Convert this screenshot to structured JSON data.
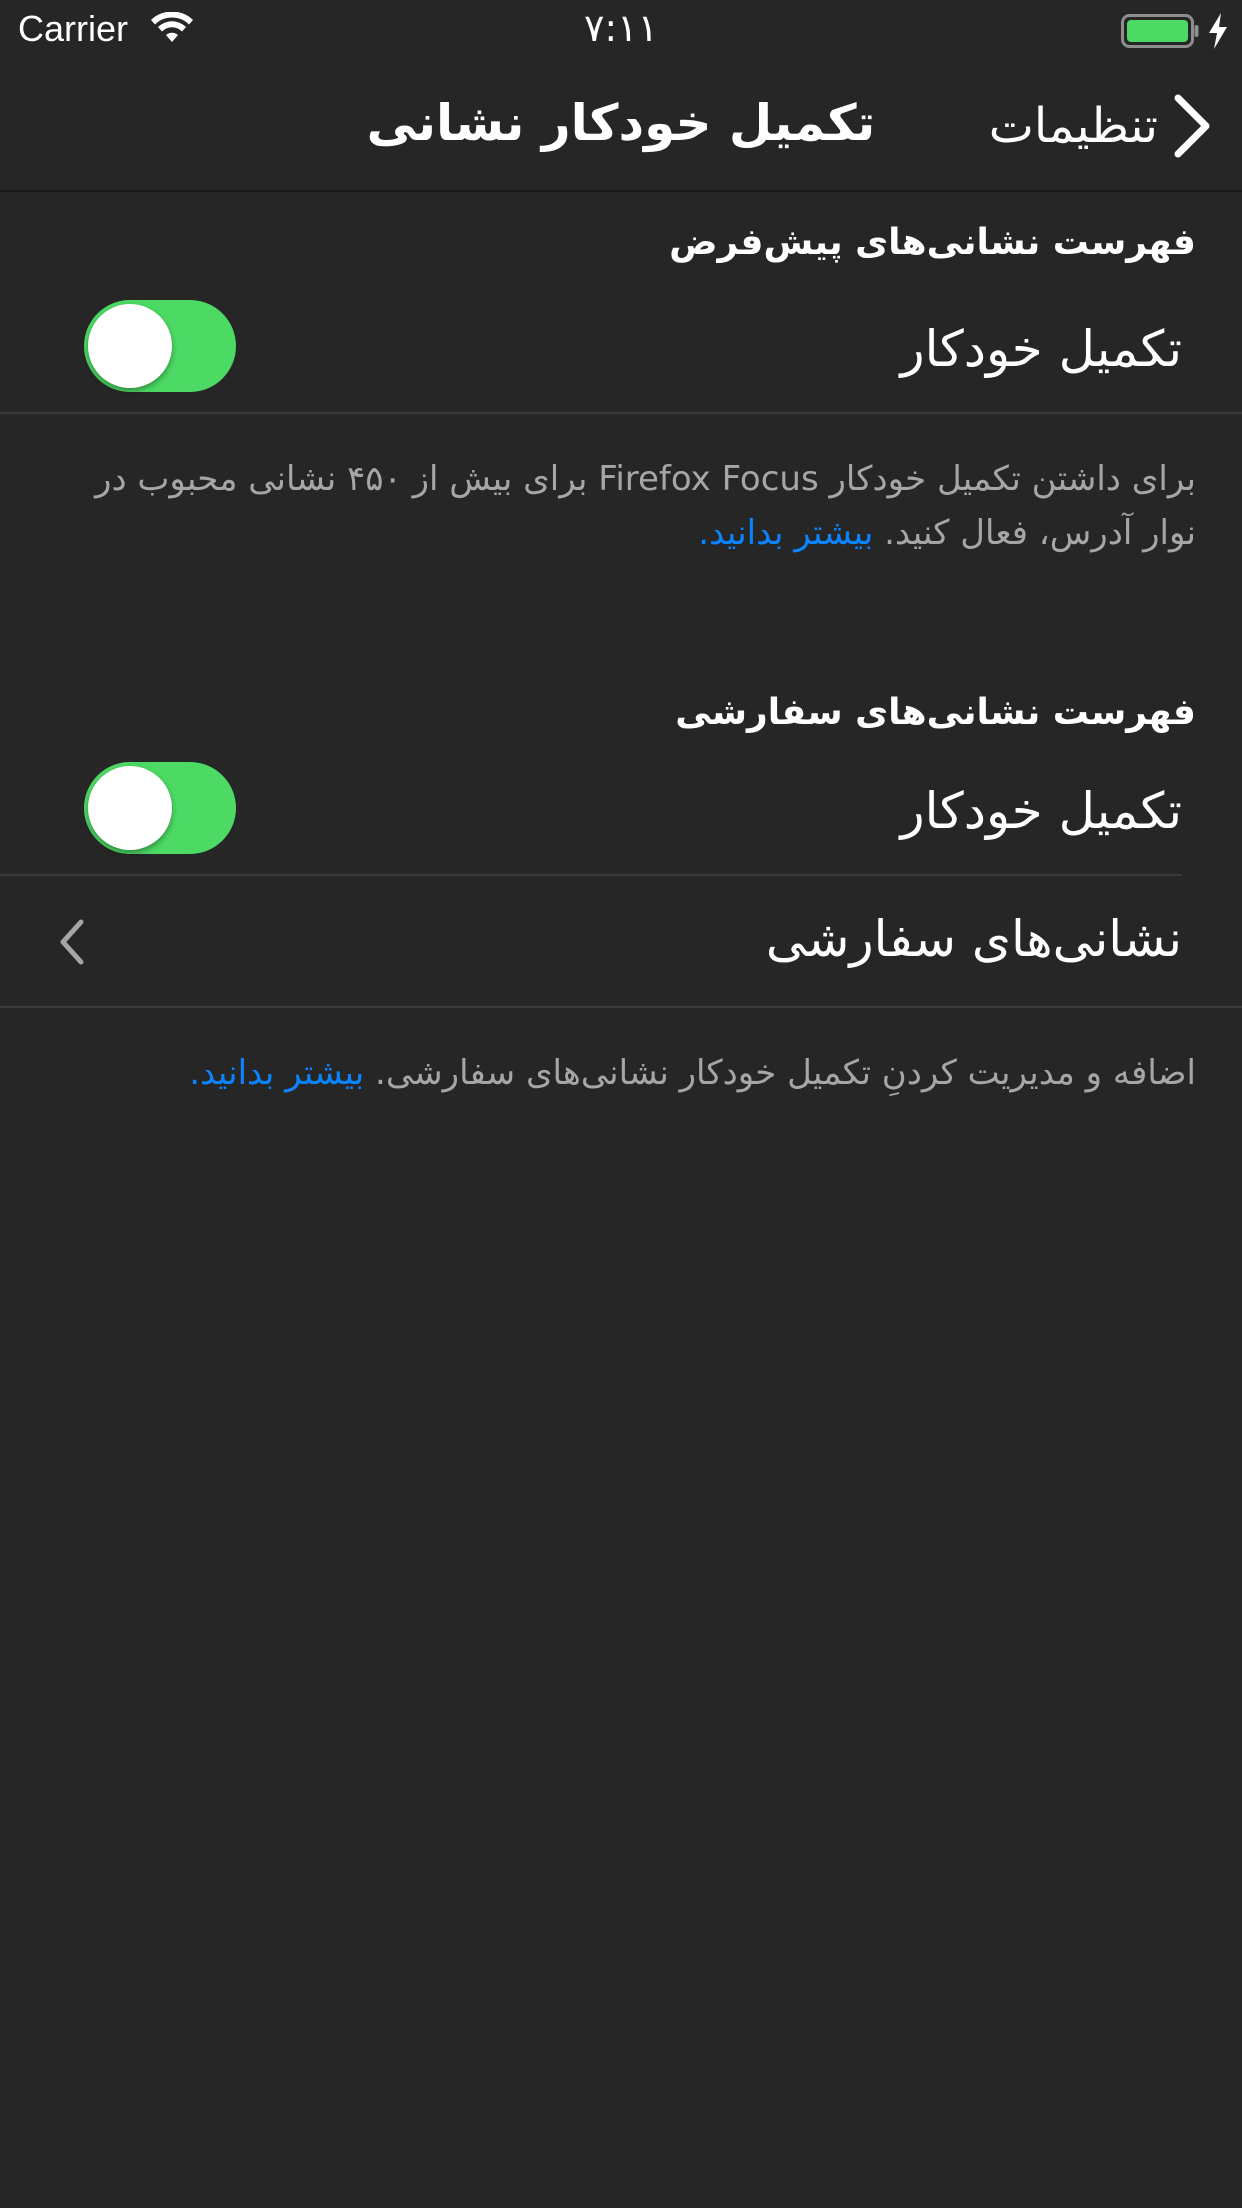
{
  "status_bar": {
    "carrier": "Carrier",
    "time": "۷:۱۱",
    "icons": [
      "wifi-icon",
      "battery-icon",
      "charging-icon"
    ],
    "battery_color": "#4cd964"
  },
  "nav": {
    "back_label": "تنظیمات",
    "back_icon": "chevron-right-icon",
    "title": "تکمیل خودکار نشانی"
  },
  "default_list": {
    "header": "فهرست نشانی‌های پیش‌فرض",
    "autocomplete_label": "تکمیل خودکار",
    "autocomplete_enabled": true,
    "footer_text": "برای داشتن تکمیل خودکار Firefox Focus برای بیش از ۴۵۰ نشانی محبوب در نوار آدرس، فعال کنید.",
    "footer_link": "بیشتر بدانید."
  },
  "custom_list": {
    "header": "فهرست نشانی‌های سفارشی",
    "autocomplete_label": "تکمیل خودکار",
    "autocomplete_enabled": true,
    "custom_urls_label": "نشانی‌های سفارشی",
    "custom_urls_icon": "chevron-left-icon",
    "footer_text": "اضافه و مدیریت کردنِ تکمیل خودکار نشانی‌های سفارشی.",
    "footer_link": "بیشتر بدانید."
  },
  "colors": {
    "background": "#262626",
    "toggle_on": "#4cd964",
    "link": "#0a84ff",
    "secondary_text": "#a6a6a6"
  }
}
